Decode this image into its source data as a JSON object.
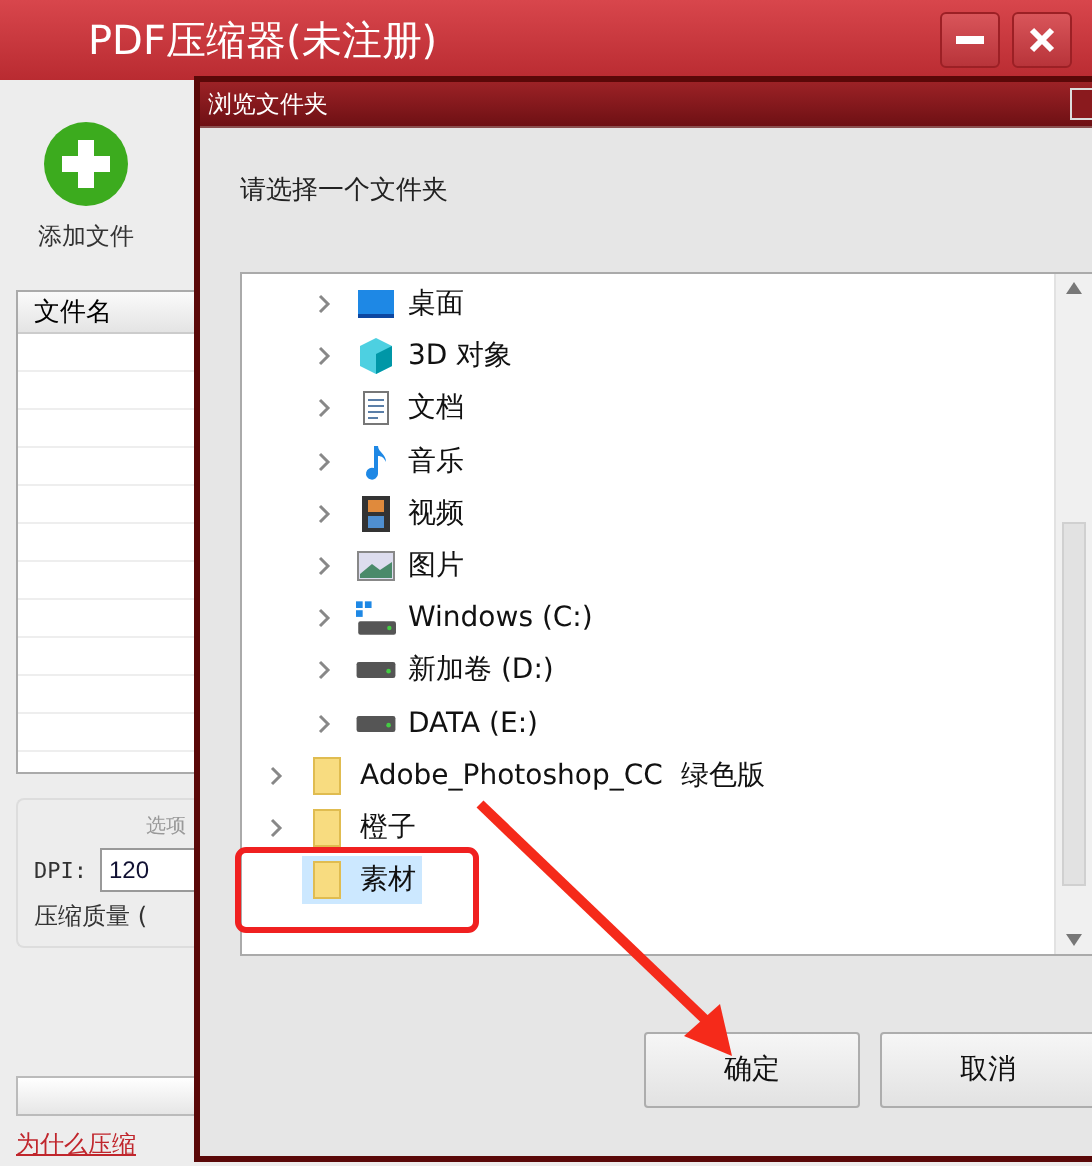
{
  "main_window": {
    "title": "PDF压缩器(未注册)",
    "add_button": "添加文件",
    "file_list": {
      "columns": [
        "文件名"
      ]
    },
    "options": {
      "legend": "选项",
      "dpi_label": "DPI:",
      "dpi_value": "120",
      "quality_label": "压缩质量 ("
    },
    "progress": {
      "level": 0
    },
    "help_link": "为什么压缩"
  },
  "dialog": {
    "title": "浏览文件夹",
    "prompt": "请选择一个文件夹",
    "tree": {
      "nested_items": [
        {
          "label": "桌面",
          "kind": "desktop",
          "expandable": true,
          "selected": false
        },
        {
          "label": "3D 对象",
          "kind": "cube",
          "expandable": true,
          "selected": false
        },
        {
          "label": "文档",
          "kind": "document",
          "expandable": true,
          "selected": false
        },
        {
          "label": "音乐",
          "kind": "music",
          "expandable": true,
          "selected": false
        },
        {
          "label": "视频",
          "kind": "video",
          "expandable": true,
          "selected": false
        },
        {
          "label": "图片",
          "kind": "picture",
          "expandable": true,
          "selected": false
        },
        {
          "label": "Windows (C:)",
          "kind": "system-drive",
          "expandable": true,
          "selected": false
        },
        {
          "label": "新加卷 (D:)",
          "kind": "drive",
          "expandable": true,
          "selected": false
        },
        {
          "label": "DATA (E:)",
          "kind": "drive",
          "expandable": true,
          "selected": false
        }
      ],
      "items": [
        {
          "label": "Adobe_Photoshop_CC  绿色版",
          "kind": "folder",
          "expandable": true,
          "selected": false
        },
        {
          "label": "橙子",
          "kind": "folder",
          "expandable": true,
          "selected": false
        },
        {
          "label": "素材",
          "kind": "folder",
          "expandable": false,
          "selected": true
        }
      ]
    },
    "buttons": [
      "确定",
      "取消"
    ]
  }
}
